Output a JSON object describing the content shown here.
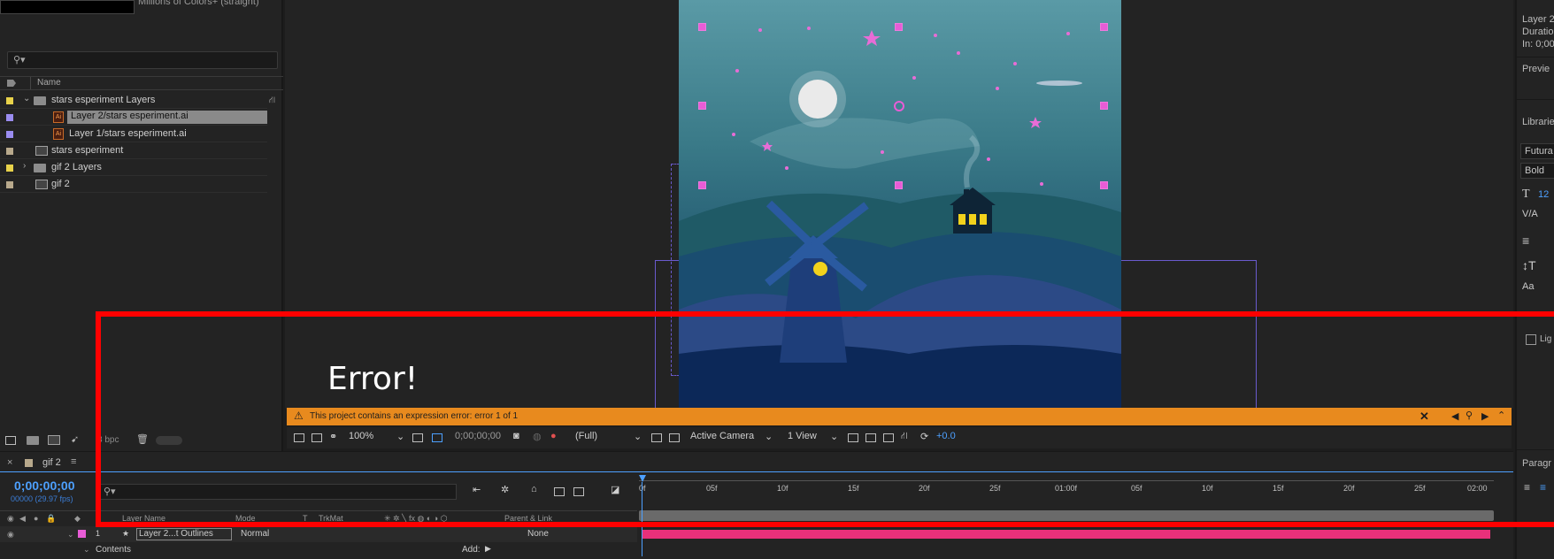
{
  "project": {
    "thumbnail_info": "Millions of Colors+ (straight)",
    "search_placeholder": "",
    "column_name": "Name",
    "items": [
      {
        "label": "stars esperiment Layers",
        "type": "folder",
        "color": "#e8d24a",
        "expanded": true,
        "indent": 0
      },
      {
        "label": "Layer 2/stars esperiment.ai",
        "type": "ai",
        "color": "#9a8cf0",
        "selected": true,
        "indent": 1
      },
      {
        "label": "Layer 1/stars esperiment.ai",
        "type": "ai",
        "color": "#9a8cf0",
        "indent": 1
      },
      {
        "label": "stars esperiment",
        "type": "comp",
        "color": "#b8a98c",
        "indent": 0
      },
      {
        "label": "gif 2 Layers",
        "type": "folder",
        "color": "#e8d24a",
        "expanded": false,
        "indent": 0
      },
      {
        "label": "gif 2",
        "type": "comp",
        "color": "#b8a98c",
        "indent": 0
      }
    ],
    "footer_bpc": "8 bpc"
  },
  "viewer": {
    "overlay_text": "Error!",
    "error_message": "This project contains an expression error: error 1 of 1",
    "zoom": "100%",
    "timecode": "0;00;00;00",
    "resolution": "(Full)",
    "camera": "Active Camera",
    "view": "1 View",
    "exposure": "+0.0"
  },
  "right_panel": {
    "info_layer": "Layer 2",
    "info_duration": "Duration",
    "info_in": "In: 0;00",
    "preview_label": "Previe",
    "libraries_label": "Libraries",
    "font_family": "Futura",
    "font_style": "Bold",
    "font_size": "12",
    "paragraph_label": "Paragr",
    "lig_label": "Lig"
  },
  "timeline": {
    "comp_tab": "gif 2",
    "timecode": "0;00;00;00",
    "fps": "00000 (29.97 fps)",
    "columns": {
      "layer_name": "Layer Name",
      "mode": "Mode",
      "t": "T",
      "trkmat": "TrkMat",
      "parent": "Parent & Link"
    },
    "ruler_ticks": [
      "0f",
      "05f",
      "10f",
      "15f",
      "20f",
      "25f",
      "01:00f",
      "05f",
      "10f",
      "15f",
      "20f",
      "25f",
      "02:00"
    ],
    "layer1": {
      "number": "1",
      "name": "Layer 2...t Outlines",
      "mode": "Normal",
      "parent": "None"
    },
    "contents_label": "Contents",
    "add_label": "Add:"
  }
}
